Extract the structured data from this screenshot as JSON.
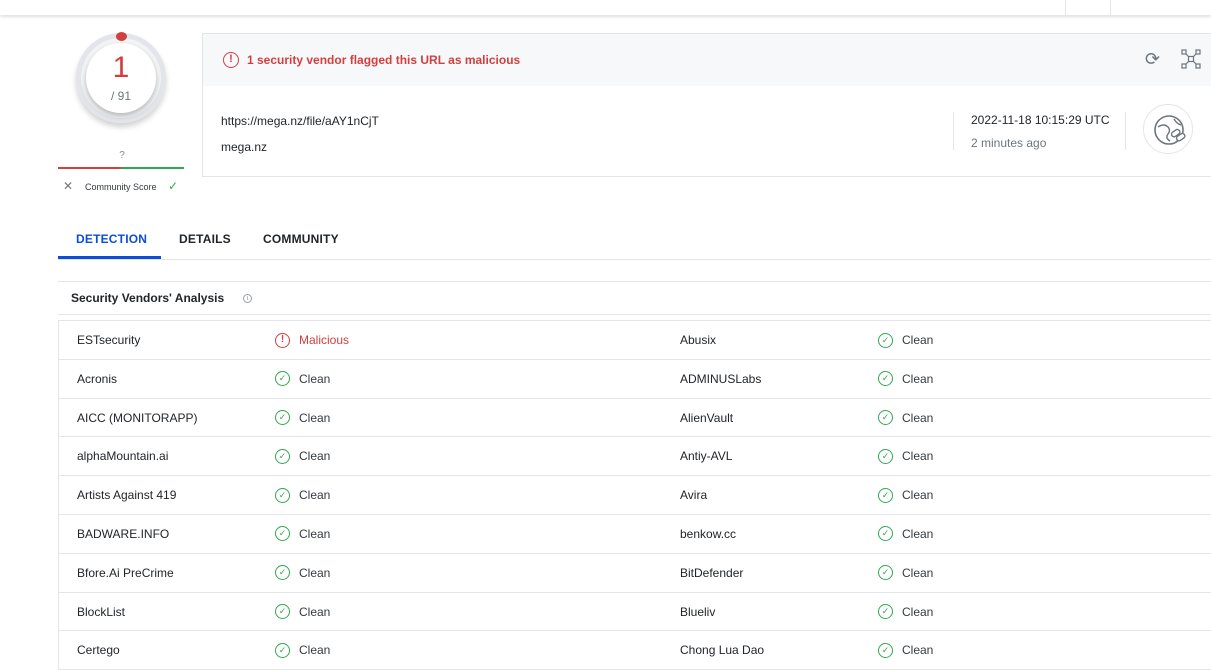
{
  "score": {
    "value": "1",
    "total": "/ 91"
  },
  "community": {
    "score_marker": "?",
    "label": "Community Score",
    "down_icon": "close-icon",
    "up_icon": "check-icon"
  },
  "alert": {
    "text": "1 security vendor flagged this URL as malicious",
    "icon": "alert-circle-icon"
  },
  "target": {
    "url": "https://mega.nz/file/aAY1nCjT",
    "domain": "mega.nz",
    "date": "2022-11-18 10:15:29 UTC",
    "ago": "2 minutes ago"
  },
  "tabs": [
    {
      "label": "DETECTION",
      "active": true
    },
    {
      "label": "DETAILS",
      "active": false
    },
    {
      "label": "COMMUNITY",
      "active": false
    }
  ],
  "section": {
    "title": "Security Vendors' Analysis"
  },
  "colors": {
    "accent": "#0b4dda",
    "malicious": "#d13f3f",
    "clean": "#2fa84f"
  },
  "vendors": [
    {
      "left": {
        "name": "ESTsecurity",
        "result": "Malicious",
        "status": "malicious"
      },
      "right": {
        "name": "Abusix",
        "result": "Clean",
        "status": "clean"
      }
    },
    {
      "left": {
        "name": "Acronis",
        "result": "Clean",
        "status": "clean"
      },
      "right": {
        "name": "ADMINUSLabs",
        "result": "Clean",
        "status": "clean"
      }
    },
    {
      "left": {
        "name": "AICC (MONITORAPP)",
        "result": "Clean",
        "status": "clean"
      },
      "right": {
        "name": "AlienVault",
        "result": "Clean",
        "status": "clean"
      }
    },
    {
      "left": {
        "name": "alphaMountain.ai",
        "result": "Clean",
        "status": "clean"
      },
      "right": {
        "name": "Antiy-AVL",
        "result": "Clean",
        "status": "clean"
      }
    },
    {
      "left": {
        "name": "Artists Against 419",
        "result": "Clean",
        "status": "clean"
      },
      "right": {
        "name": "Avira",
        "result": "Clean",
        "status": "clean"
      }
    },
    {
      "left": {
        "name": "BADWARE.INFO",
        "result": "Clean",
        "status": "clean"
      },
      "right": {
        "name": "benkow.cc",
        "result": "Clean",
        "status": "clean"
      }
    },
    {
      "left": {
        "name": "Bfore.Ai PreCrime",
        "result": "Clean",
        "status": "clean"
      },
      "right": {
        "name": "BitDefender",
        "result": "Clean",
        "status": "clean"
      }
    },
    {
      "left": {
        "name": "BlockList",
        "result": "Clean",
        "status": "clean"
      },
      "right": {
        "name": "Blueliv",
        "result": "Clean",
        "status": "clean"
      }
    },
    {
      "left": {
        "name": "Certego",
        "result": "Clean",
        "status": "clean"
      },
      "right": {
        "name": "Chong Lua Dao",
        "result": "Clean",
        "status": "clean"
      }
    }
  ]
}
